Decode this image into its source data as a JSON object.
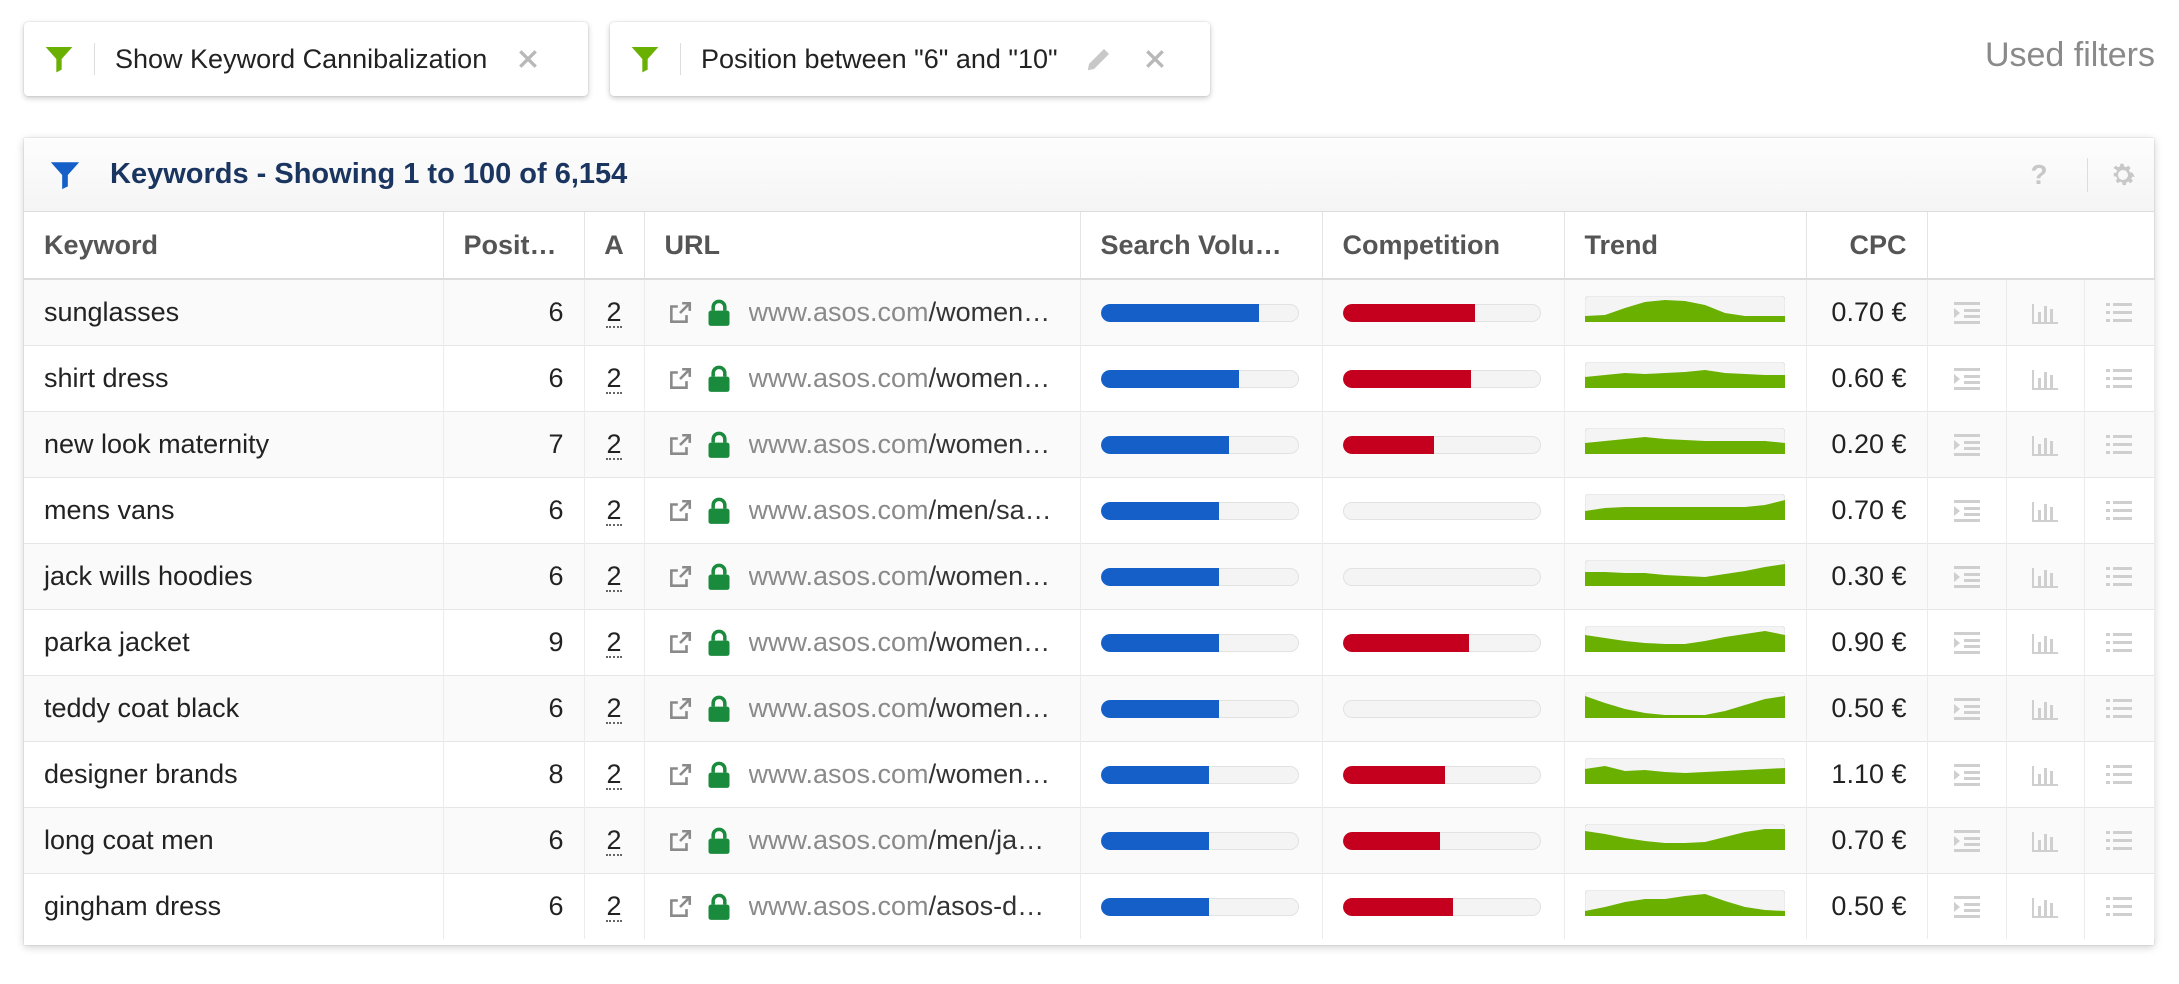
{
  "filters": {
    "chips": [
      {
        "label": "Show Keyword Cannibalization",
        "icon": "funnel-icon",
        "editable": false
      },
      {
        "label": "Position between \"6\" and \"10\"",
        "icon": "funnel-icon",
        "editable": true
      }
    ],
    "used_filters_label": "Used filters"
  },
  "panel": {
    "title": "Keywords - Showing 1 to 100 of 6,154",
    "help_label": "?",
    "columns": {
      "keyword": "Keyword",
      "position": "Positi…",
      "a": "A",
      "url": "URL",
      "search_volume": "Search Volum…",
      "competition": "Competition",
      "trend": "Trend",
      "cpc": "CPC"
    },
    "colors": {
      "volume": "#1560c8",
      "competition": "#c4001e",
      "trend": "#6ab000",
      "funnel_green": "#6ab000",
      "funnel_blue": "#1560c8",
      "lock": "#1a8a3c"
    },
    "rows": [
      {
        "keyword": "sunglasses",
        "position": "6",
        "a": "2",
        "url_domain": "www.asos.com",
        "url_path": "/women…",
        "volume": 0.8,
        "competition": 0.67,
        "trend": [
          0.15,
          0.2,
          0.55,
          0.85,
          0.95,
          0.9,
          0.7,
          0.3,
          0.15,
          0.15,
          0.15
        ],
        "cpc": "0.70 €"
      },
      {
        "keyword": "shirt dress",
        "position": "6",
        "a": "2",
        "url_domain": "www.asos.com",
        "url_path": "/women…",
        "volume": 0.7,
        "competition": 0.65,
        "trend": [
          0.4,
          0.5,
          0.6,
          0.55,
          0.6,
          0.65,
          0.75,
          0.6,
          0.55,
          0.5,
          0.5
        ],
        "cpc": "0.60 €"
      },
      {
        "keyword": "new look maternity",
        "position": "7",
        "a": "2",
        "url_domain": "www.asos.com",
        "url_path": "/women…",
        "volume": 0.65,
        "competition": 0.46,
        "trend": [
          0.4,
          0.5,
          0.6,
          0.7,
          0.6,
          0.55,
          0.5,
          0.5,
          0.5,
          0.5,
          0.4
        ],
        "cpc": "0.20 €"
      },
      {
        "keyword": "mens vans",
        "position": "6",
        "a": "2",
        "url_domain": "www.asos.com",
        "url_path": "/men/sa…",
        "volume": 0.6,
        "competition": 0.0,
        "trend": [
          0.3,
          0.45,
          0.5,
          0.5,
          0.5,
          0.5,
          0.5,
          0.5,
          0.5,
          0.6,
          0.85
        ],
        "cpc": "0.70 €"
      },
      {
        "keyword": "jack wills hoodies",
        "position": "6",
        "a": "2",
        "url_domain": "www.asos.com",
        "url_path": "/women…",
        "volume": 0.6,
        "competition": 0.0,
        "trend": [
          0.55,
          0.55,
          0.5,
          0.5,
          0.4,
          0.35,
          0.3,
          0.45,
          0.6,
          0.8,
          0.95
        ],
        "cpc": "0.30 €"
      },
      {
        "keyword": "parka jacket",
        "position": "9",
        "a": "2",
        "url_domain": "www.asos.com",
        "url_path": "/women…",
        "volume": 0.6,
        "competition": 0.64,
        "trend": [
          0.7,
          0.55,
          0.4,
          0.3,
          0.25,
          0.25,
          0.4,
          0.6,
          0.75,
          0.9,
          0.7
        ],
        "cpc": "0.90 €"
      },
      {
        "keyword": "teddy coat black",
        "position": "6",
        "a": "2",
        "url_domain": "www.asos.com",
        "url_path": "/women…",
        "volume": 0.6,
        "competition": 0.0,
        "trend": [
          0.95,
          0.6,
          0.3,
          0.1,
          0.0,
          0.0,
          0.0,
          0.2,
          0.5,
          0.8,
          0.95
        ],
        "cpc": "0.50 €"
      },
      {
        "keyword": "designer brands",
        "position": "8",
        "a": "2",
        "url_domain": "www.asos.com",
        "url_path": "/women…",
        "volume": 0.55,
        "competition": 0.52,
        "trend": [
          0.6,
          0.75,
          0.5,
          0.55,
          0.45,
          0.4,
          0.45,
          0.5,
          0.55,
          0.6,
          0.65
        ],
        "cpc": "1.10 €"
      },
      {
        "keyword": "long coat men",
        "position": "6",
        "a": "2",
        "url_domain": "www.asos.com",
        "url_path": "/men/ja…",
        "volume": 0.55,
        "competition": 0.49,
        "trend": [
          0.8,
          0.65,
          0.45,
          0.3,
          0.2,
          0.2,
          0.25,
          0.5,
          0.75,
          0.9,
          0.9
        ],
        "cpc": "0.70 €"
      },
      {
        "keyword": "gingham dress",
        "position": "6",
        "a": "2",
        "url_domain": "www.asos.com",
        "url_path": "/asos-d…",
        "volume": 0.55,
        "competition": 0.56,
        "trend": [
          0.1,
          0.3,
          0.55,
          0.7,
          0.7,
          0.85,
          0.95,
          0.6,
          0.3,
          0.15,
          0.1
        ],
        "cpc": "0.50 €"
      }
    ],
    "row_action_icons": [
      "indent-icon",
      "bar-chart-icon",
      "list-icon"
    ]
  }
}
